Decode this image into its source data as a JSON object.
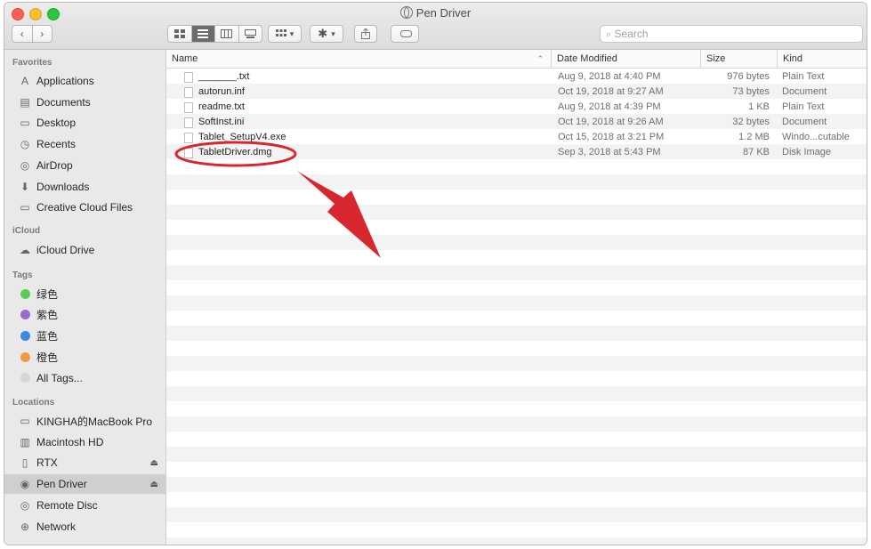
{
  "window": {
    "title": "Pen Driver"
  },
  "toolbar": {
    "back": "‹",
    "forward": "›",
    "search_placeholder": "Search"
  },
  "sidebar": {
    "favorites_header": "Favorites",
    "favorites": [
      {
        "label": "Applications",
        "icon": "applications-icon"
      },
      {
        "label": "Documents",
        "icon": "documents-icon"
      },
      {
        "label": "Desktop",
        "icon": "desktop-icon"
      },
      {
        "label": "Recents",
        "icon": "recents-icon"
      },
      {
        "label": "AirDrop",
        "icon": "airdrop-icon"
      },
      {
        "label": "Downloads",
        "icon": "downloads-icon"
      },
      {
        "label": "Creative Cloud Files",
        "icon": "folder-icon"
      }
    ],
    "icloud_header": "iCloud",
    "icloud": [
      {
        "label": "iCloud Drive",
        "icon": "cloud-icon"
      }
    ],
    "tags_header": "Tags",
    "tags": [
      {
        "label": "绿色",
        "color": "#5fc95a"
      },
      {
        "label": "紫色",
        "color": "#9b6ad3"
      },
      {
        "label": "蓝色",
        "color": "#3d88e0"
      },
      {
        "label": "橙色",
        "color": "#f09a3c"
      },
      {
        "label": "All Tags...",
        "color": "#d6d6d6"
      }
    ],
    "locations_header": "Locations",
    "locations": [
      {
        "label": "KINGHA的MacBook Pro",
        "icon": "laptop-icon",
        "eject": ""
      },
      {
        "label": "Macintosh HD",
        "icon": "hard-drive-icon",
        "eject": ""
      },
      {
        "label": "RTX",
        "icon": "drive-icon",
        "eject": "⏏"
      },
      {
        "label": "Pen Driver",
        "icon": "disc-icon",
        "eject": "⏏",
        "selected": true
      },
      {
        "label": "Remote Disc",
        "icon": "remote-disc-icon",
        "eject": ""
      },
      {
        "label": "Network",
        "icon": "network-icon",
        "eject": ""
      }
    ]
  },
  "list": {
    "columns": {
      "name": "Name",
      "date": "Date Modified",
      "size": "Size",
      "kind": "Kind"
    },
    "files": [
      {
        "name": "_______.txt",
        "date": "Aug 9, 2018 at 4:40 PM",
        "size": "976 bytes",
        "kind": "Plain Text"
      },
      {
        "name": "autorun.inf",
        "date": "Oct 19, 2018 at 9:27 AM",
        "size": "73 bytes",
        "kind": "Document"
      },
      {
        "name": "readme.txt",
        "date": "Aug 9, 2018 at 4:39 PM",
        "size": "1 KB",
        "kind": "Plain Text"
      },
      {
        "name": "SoftInst.ini",
        "date": "Oct 19, 2018 at 9:26 AM",
        "size": "32 bytes",
        "kind": "Document"
      },
      {
        "name": "Tablet_SetupV4.exe",
        "date": "Oct 15, 2018 at 3:21 PM",
        "size": "1.2 MB",
        "kind": "Windo...cutable"
      },
      {
        "name": "TabletDriver.dmg",
        "date": "Sep 3, 2018 at 5:43 PM",
        "size": "87 KB",
        "kind": "Disk Image"
      }
    ]
  },
  "annotation": {
    "color": "#d7262e"
  }
}
